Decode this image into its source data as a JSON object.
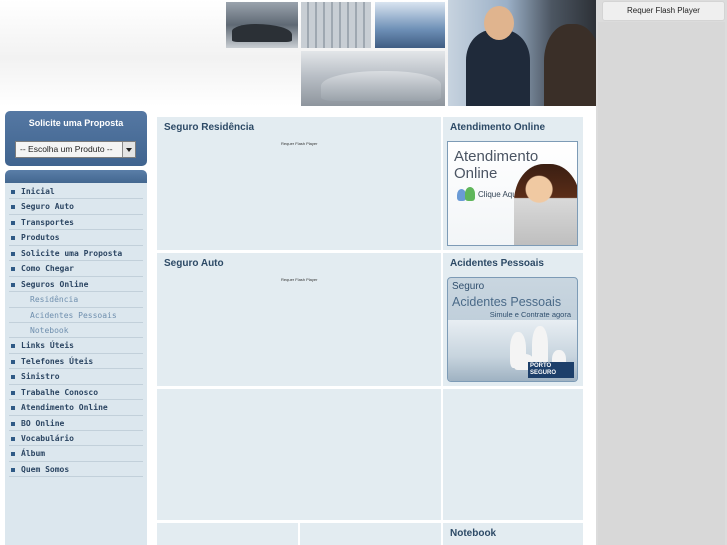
{
  "header": {
    "flash_placeholder": "Requer Flash Player"
  },
  "sidebar": {
    "proposal": {
      "title": "Solicite uma Proposta",
      "select_value": "-- Escolha um Produto --"
    },
    "nav": [
      {
        "label": "Inicial",
        "sub": false
      },
      {
        "label": "Seguro Auto",
        "sub": false
      },
      {
        "label": "Transportes",
        "sub": false
      },
      {
        "label": "Produtos",
        "sub": false
      },
      {
        "label": "Solicite uma Proposta",
        "sub": false
      },
      {
        "label": "Como Chegar",
        "sub": false
      },
      {
        "label": "Seguros Online",
        "sub": false
      },
      {
        "label": "Residência",
        "sub": true
      },
      {
        "label": "Acidentes Pessoais",
        "sub": true
      },
      {
        "label": "Notebook",
        "sub": true
      },
      {
        "label": "Links Úteis",
        "sub": false
      },
      {
        "label": "Telefones Úteis",
        "sub": false
      },
      {
        "label": "Sinistro",
        "sub": false
      },
      {
        "label": "Trabalhe Conosco",
        "sub": false
      },
      {
        "label": "Atendimento Online",
        "sub": false
      },
      {
        "label": "BO Online",
        "sub": false
      },
      {
        "label": "Vocabulário",
        "sub": false
      },
      {
        "label": "Álbum",
        "sub": false
      },
      {
        "label": "Quem Somos",
        "sub": false
      }
    ]
  },
  "main": {
    "residencia": {
      "title": "Seguro Residência",
      "flash": "Requer Flash Player"
    },
    "auto": {
      "title": "Seguro Auto",
      "flash": "Requer Flash Player"
    },
    "atendimento": {
      "title": "Atendimento Online",
      "banner_line1": "Atendimento",
      "banner_line2": "Online",
      "banner_cta": "Clique Aqui!"
    },
    "acidentes": {
      "title": "Acidentes Pessoais",
      "banner_line1": "Seguro",
      "banner_line2": "Acidentes Pessoais",
      "banner_line3": "Simule e Contrate agora",
      "brand_line1": "PORTO",
      "brand_line2": "SEGURO"
    },
    "notebook": {
      "title": "Notebook"
    }
  },
  "colors": {
    "accent": "#43678f",
    "panel_bg": "#e3ecf1",
    "nav_text": "#2c4663"
  }
}
